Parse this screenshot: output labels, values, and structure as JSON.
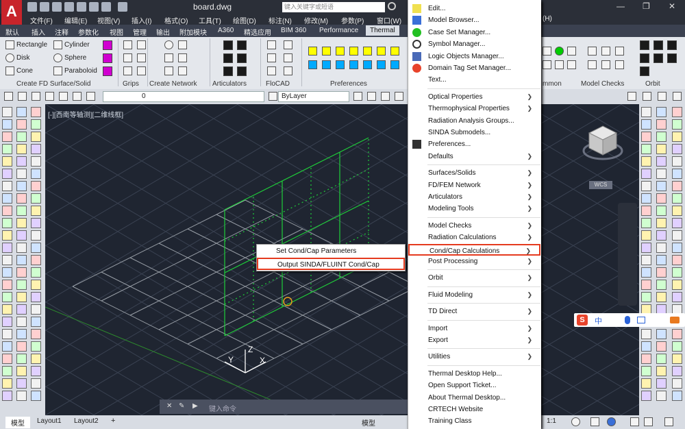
{
  "app": {
    "doc_title": "board.dwg",
    "search_placeholder": "键入关键字或短语",
    "logo": "A"
  },
  "menubar": [
    "文件(F)",
    "编辑(E)",
    "视图(V)",
    "插入(I)",
    "格式(O)",
    "工具(T)",
    "绘图(D)",
    "标注(N)",
    "修改(M)",
    "参数(P)",
    "窗口(W)",
    "(H)"
  ],
  "ribbon_tabs": [
    "默认",
    "插入",
    "注释",
    "参数化",
    "视图",
    "管理",
    "输出",
    "附加模块",
    "A360",
    "精选应用",
    "BIM 360",
    "Performance",
    "Thermal"
  ],
  "ribbon": {
    "shapes": [
      "Rectangle",
      "Cylinder",
      "Disk",
      "Sphere",
      "Cone",
      "Paraboloid"
    ],
    "panels": [
      "Create FD Surface/Solid",
      "Grips",
      "Create Network",
      "Articulators",
      "FloCAD",
      "Preferences"
    ],
    "right_panels": [
      "mmon",
      "Model Checks",
      "Orbit"
    ]
  },
  "props": {
    "layer_value": "0",
    "color_value": "ByLayer"
  },
  "viewport": {
    "label": "[-][西南等轴测][二维线框]",
    "ucs_x": "X",
    "ucs_y": "Y",
    "ucs_z": "Z",
    "wcs": "WCS"
  },
  "context_menu": [
    {
      "label": "Set Cond/Cap Parameters",
      "highlight": false
    },
    {
      "label": "Output SINDA/FLUINT Cond/Cap",
      "highlight": true
    }
  ],
  "menu": [
    {
      "label": "Edit...",
      "arrow": false,
      "sep": false
    },
    {
      "label": "Model Browser...",
      "arrow": false,
      "sep": false
    },
    {
      "label": "Case Set Manager...",
      "arrow": false,
      "sep": false
    },
    {
      "label": "Symbol Manager...",
      "arrow": false,
      "sep": false
    },
    {
      "label": "Logic Objects Manager...",
      "arrow": false,
      "sep": false
    },
    {
      "label": "Domain Tag Set Manager...",
      "arrow": false,
      "sep": false
    },
    {
      "label": "Text...",
      "arrow": false,
      "sep": true
    },
    {
      "label": "Optical Properties",
      "arrow": true,
      "sep": false
    },
    {
      "label": "Thermophysical Properties",
      "arrow": true,
      "sep": false
    },
    {
      "label": "Radiation Analysis Groups...",
      "arrow": false,
      "sep": false
    },
    {
      "label": "SINDA Submodels...",
      "arrow": false,
      "sep": false
    },
    {
      "label": "Preferences...",
      "arrow": false,
      "sep": false
    },
    {
      "label": "Defaults",
      "arrow": true,
      "sep": true
    },
    {
      "label": "Surfaces/Solids",
      "arrow": true,
      "sep": false
    },
    {
      "label": "FD/FEM Network",
      "arrow": true,
      "sep": false
    },
    {
      "label": "Articulators",
      "arrow": true,
      "sep": false
    },
    {
      "label": "Modeling Tools",
      "arrow": true,
      "sep": true
    },
    {
      "label": "Model Checks",
      "arrow": true,
      "sep": false
    },
    {
      "label": "Radiation Calculations",
      "arrow": true,
      "sep": false
    },
    {
      "label": "Cond/Cap Calculations",
      "arrow": true,
      "sep": false,
      "highlight": true
    },
    {
      "label": "Post Processing",
      "arrow": true,
      "sep": true
    },
    {
      "label": "Orbit",
      "arrow": true,
      "sep": true
    },
    {
      "label": "Fluid Modeling",
      "arrow": true,
      "sep": true
    },
    {
      "label": "TD Direct",
      "arrow": true,
      "sep": true
    },
    {
      "label": "Import",
      "arrow": true,
      "sep": false
    },
    {
      "label": "Export",
      "arrow": true,
      "sep": true
    },
    {
      "label": "Utilities",
      "arrow": true,
      "sep": true
    },
    {
      "label": "Thermal Desktop Help...",
      "arrow": false,
      "sep": false
    },
    {
      "label": "Open Support Ticket...",
      "arrow": false,
      "sep": false
    },
    {
      "label": "About Thermal Desktop...",
      "arrow": false,
      "sep": false
    },
    {
      "label": "CRTECH Website",
      "arrow": false,
      "sep": false
    },
    {
      "label": "Training Class",
      "arrow": false,
      "sep": false
    }
  ],
  "layout_tabs": [
    "模型",
    "Layout1",
    "Layout2",
    "+"
  ],
  "cmdline_placeholder": "键入命令",
  "status": {
    "model": "模型",
    "scale": "1:1"
  },
  "ime": {
    "label": "中"
  }
}
